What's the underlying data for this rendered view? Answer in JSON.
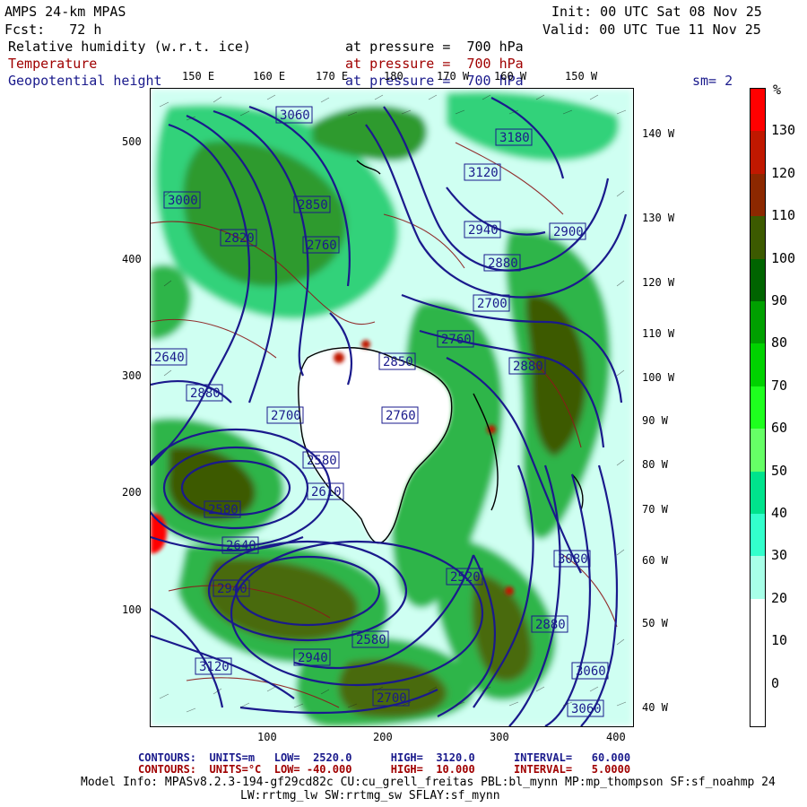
{
  "header": {
    "model": "AMPS 24-km MPAS",
    "init": "Init: 00 UTC Sat 08 Nov 25",
    "fcst": "Fcst:   72 h",
    "valid": "Valid: 00 UTC Tue 11 Nov 25",
    "field1": "Relative humidity (w.r.t. ice)",
    "field2": "Temperature",
    "field3": "Geopotential height",
    "pressure": "at pressure =  700 hPa",
    "sm": "sm= 2"
  },
  "colorbar": {
    "unit": "%",
    "labels": [
      "130",
      "120",
      "110",
      "100",
      "90",
      "80",
      "70",
      "60",
      "50",
      "40",
      "30",
      "20",
      "10",
      "0"
    ],
    "colors": [
      "#ff0000",
      "#c01800",
      "#8c2800",
      "#3c5a00",
      "#006400",
      "#00a000",
      "#00d200",
      "#1eff1e",
      "#66ff66",
      "#00e38c",
      "#33ffcc",
      "#a8ffe8",
      "#ffffff",
      "#ffffff",
      "#ffffff"
    ]
  },
  "axes": {
    "x_ticks": [
      "100",
      "200",
      "300",
      "400"
    ],
    "y_ticks": [
      "500",
      "400",
      "300",
      "200",
      "100"
    ],
    "lon_top": [
      "150 E",
      "160 E",
      "170 E",
      "180",
      "170 W",
      "160 W",
      "150 W"
    ],
    "lon_right": [
      "140 W",
      "130 W",
      "120 W",
      "110 W",
      "100 W",
      "90 W",
      "80 W",
      "70 W",
      "60 W",
      "50 W",
      "40 W"
    ]
  },
  "map": {
    "height_labels": [
      "3060",
      "3000",
      "2850",
      "2820",
      "2760",
      "2940",
      "2880",
      "3120",
      "3180",
      "2900",
      "2700",
      "2760",
      "2880",
      "2640",
      "2880",
      "2850",
      "2700",
      "2580",
      "2760",
      "2610",
      "2580",
      "2640",
      "2520",
      "2940",
      "2880",
      "3060",
      "3120",
      "3080",
      "3060",
      "2940",
      "2580",
      "2700"
    ]
  },
  "footer": {
    "line1_a": "CONTOURS:  UNITS=m   LOW=  2520.0      HIGH=  3120.0      INTERVAL=   60.000",
    "line2_a": "CONTOURS:  UNITS=°C  LOW= -40.000      HIGH=  10.000      INTERVAL=   5.0000",
    "model_info": "Model Info: MPASv8.2.3-194-gf29cd82c CU:cu_grell_freitas PBL:bl_mynn MP:mp_thompson SF:sf_noahmp 24",
    "model_info2": "LW:rrtmg_lw SW:rrtmg_sw SFLAY:sf_mynn"
  }
}
